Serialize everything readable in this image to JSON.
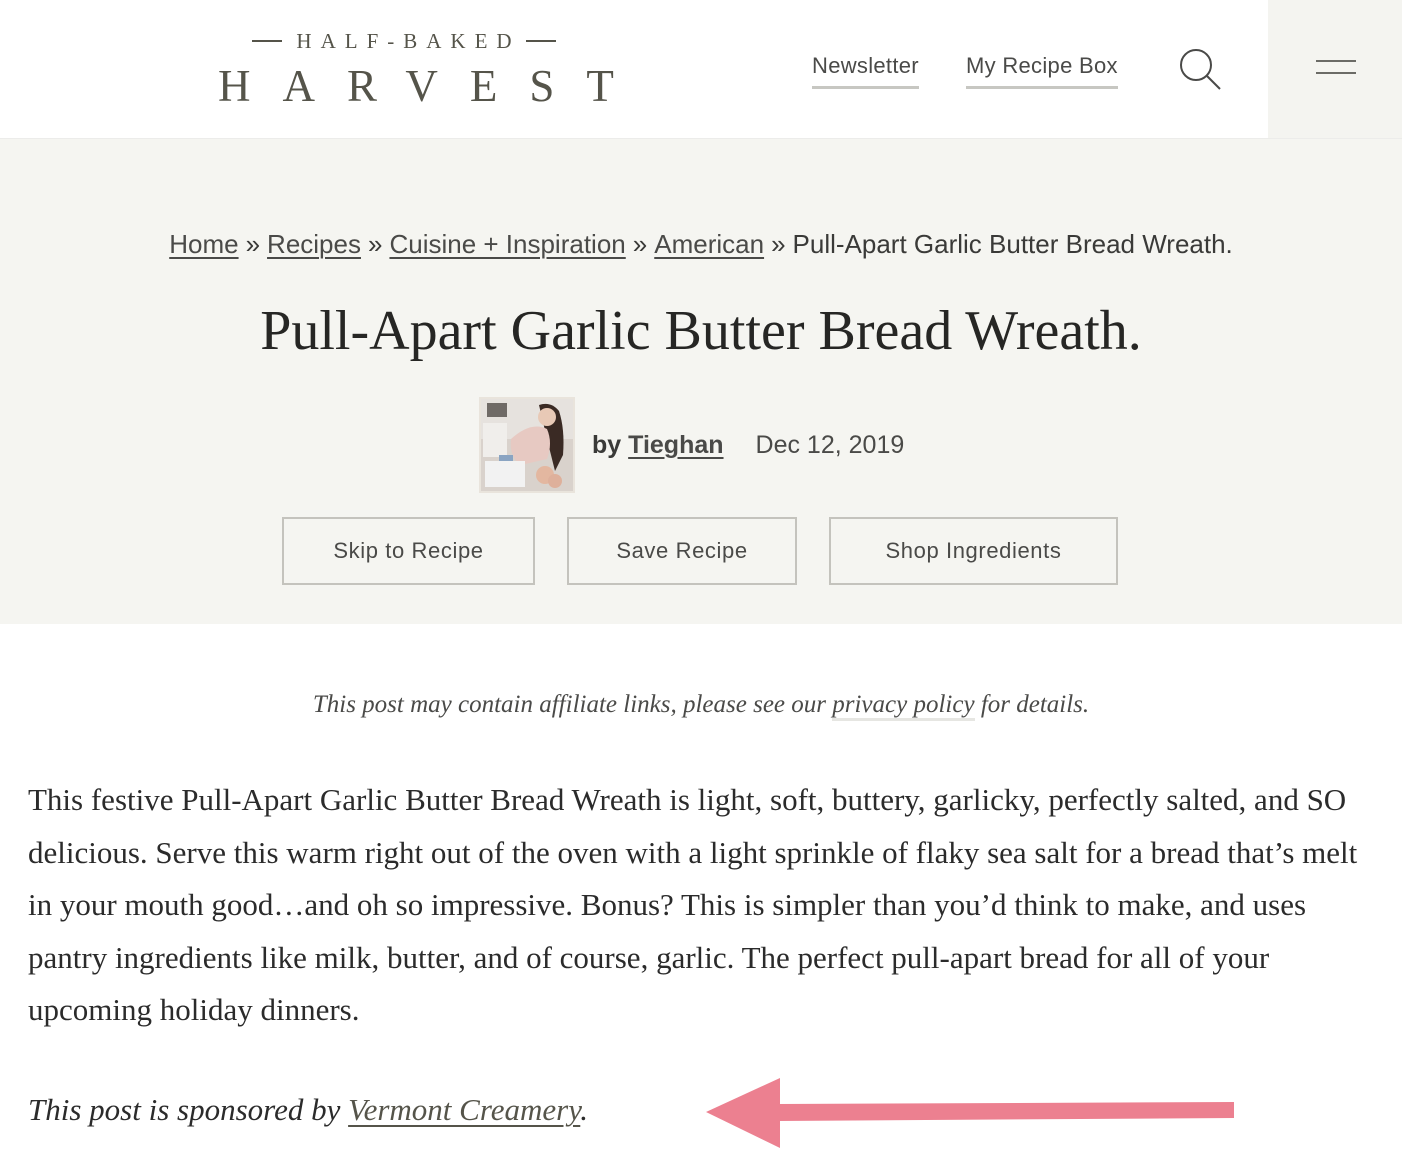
{
  "header": {
    "logo_top": "HALF-BAKED",
    "logo_main": "HARVEST",
    "nav": [
      {
        "label": "Newsletter"
      },
      {
        "label": "My Recipe Box"
      }
    ],
    "search_icon": "search-icon",
    "menu_icon": "hamburger-menu-icon"
  },
  "breadcrumb": {
    "items": [
      {
        "label": "Home",
        "link": true
      },
      {
        "label": "Recipes",
        "link": true
      },
      {
        "label": "Cuisine + Inspiration",
        "link": true
      },
      {
        "label": "American",
        "link": true
      },
      {
        "label": "Pull-Apart Garlic Butter Bread Wreath.",
        "link": false
      }
    ],
    "separator": "»"
  },
  "post": {
    "title": "Pull-Apart Garlic Butter Bread Wreath.",
    "by_label": "by",
    "author": "Tieghan",
    "date": "Dec 12, 2019"
  },
  "actions": {
    "skip": "Skip to Recipe",
    "save": "Save Recipe",
    "shop": "Shop Ingredients"
  },
  "disclaimer": {
    "before": "This post may contain affiliate links, please see our ",
    "link": "privacy policy",
    "after": " for details."
  },
  "intro": "This festive Pull-Apart Garlic Butter Bread Wreath is light, soft, buttery, garlicky, perfectly salted, and SO delicious. Serve this warm right out of the oven with a light sprinkle of flaky sea salt for a bread that’s melt in your mouth good…and oh so impressive. Bonus? This is simpler than you’d think to make, and uses pantry ingredients like milk, butter, and of course, garlic. The perfect pull-apart bread for all of your upcoming holiday dinners.",
  "sponsor": {
    "before": "This post is sponsored by ",
    "link": "Vermont Creamery",
    "after": "."
  },
  "annotation": {
    "arrow_color": "#ec8090",
    "points_to": "sponsor-link"
  },
  "colors": {
    "hero_bg": "#f5f5f1",
    "logo": "#55544a",
    "text": "#2b2b2b"
  }
}
